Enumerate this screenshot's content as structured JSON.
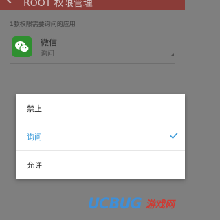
{
  "header": {
    "title": "ROOT 权限管理"
  },
  "section_hint": "1款权限需要询问的应用",
  "app": {
    "name": "微信",
    "status": "询问",
    "icon": "wechat-icon"
  },
  "dialog": {
    "options": [
      {
        "label": "禁止"
      },
      {
        "label": "询问",
        "selected": true
      },
      {
        "label": "允许"
      }
    ],
    "selected_color": "#3a9ad9"
  },
  "watermark": {
    "brand": "UCBUG",
    "site": "游戏网"
  }
}
